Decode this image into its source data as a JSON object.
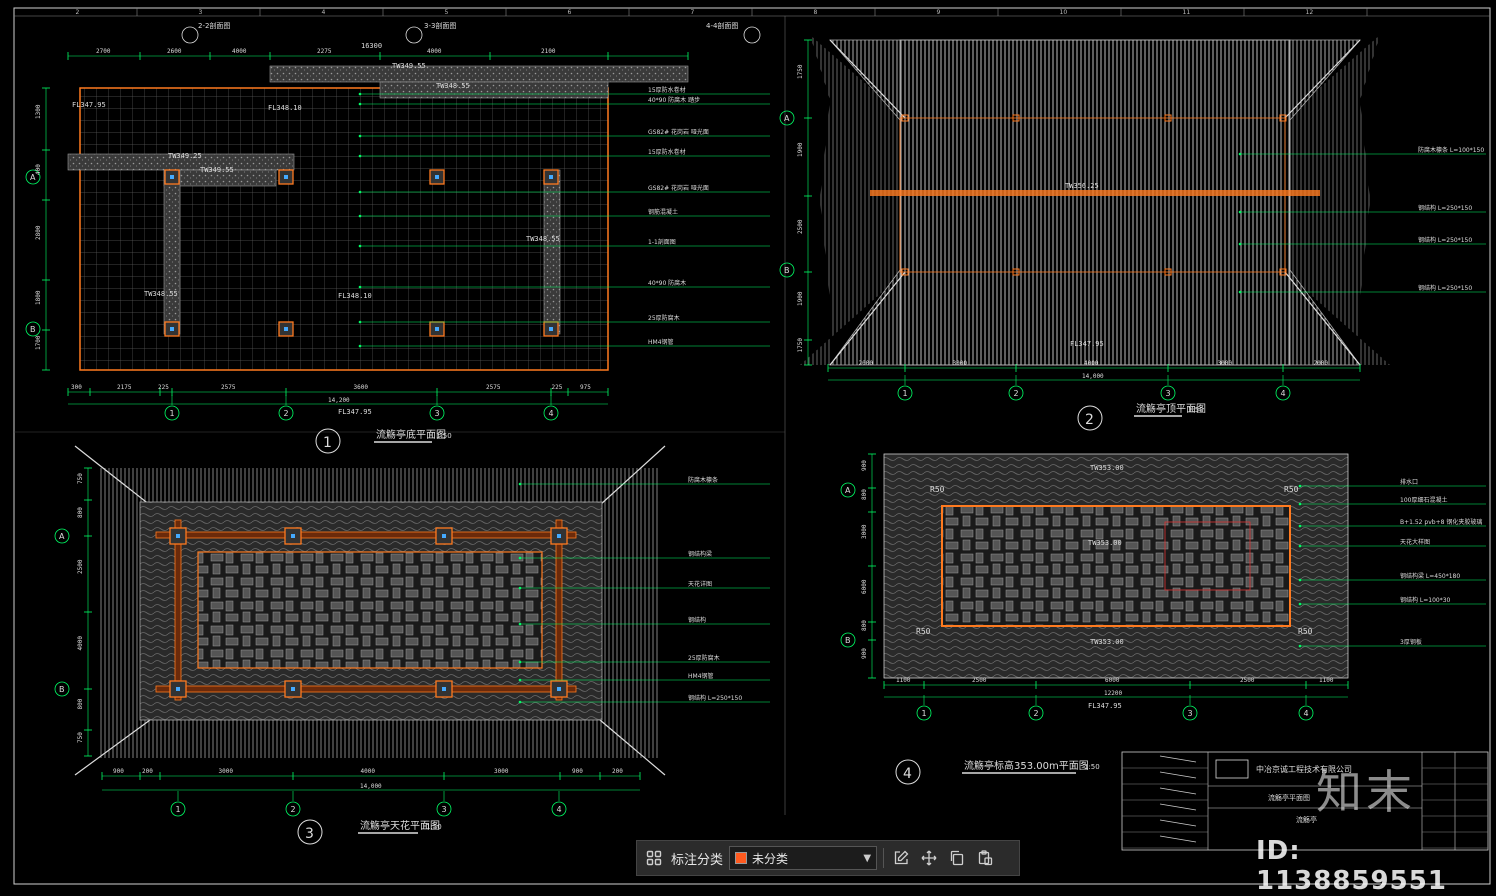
{
  "colors": {
    "bg": "#000000",
    "frame": "#ffffff",
    "dim": "#00ff66",
    "accent": "#ff7a1f",
    "hatch": "#777777",
    "label": "#dddddd"
  },
  "grid": {
    "cols": [
      "2",
      "3",
      "4",
      "5",
      "6",
      "7",
      "8",
      "9",
      "10",
      "11",
      "12"
    ],
    "rows": [
      "A",
      "B"
    ]
  },
  "view1": {
    "title": "流觞亭底平面图",
    "scale": "1:50",
    "number": "1",
    "top_dims": [
      "2700",
      "2600",
      "4000",
      "2275",
      "4000",
      "2100"
    ],
    "total": "16300",
    "bottom_dims": [
      "300",
      "2175",
      "225",
      "2575",
      "3600",
      "2575",
      "225",
      "975",
      "300"
    ],
    "bottom_total": "14,200",
    "axes": [
      "1",
      "2",
      "3",
      "4"
    ],
    "levels": {
      "a": "FL347.95",
      "b": "FL348.10",
      "c": "TW349.25",
      "d": "TW349.55",
      "e": "TW348.55",
      "f": "FL348.10",
      "g": "FL347.95"
    },
    "callouts": [
      "15厚防水卷材",
      "40*90 防腐木 踏步",
      "GS82# 花岗岩 哑光面",
      "15厚防水卷材",
      "GS82# 花岗岩 哑光面",
      "钢筋混凝土",
      "1-1剖面图",
      "40*90 防腐木",
      "25厚防腐木",
      "HM4钢管"
    ],
    "sections": [
      "2-2剖面图",
      "3-3剖面图",
      "4-4剖面图"
    ]
  },
  "view2": {
    "title": "流觞亭顶平面图",
    "scale": "1:50",
    "number": "2",
    "bottom_dims": [
      "2000",
      "3000",
      "4000",
      "3000",
      "2000"
    ],
    "total": "14,000",
    "axes": [
      "1",
      "2",
      "3",
      "4"
    ],
    "level": "FL347.95",
    "ridge": "TW356.25",
    "left_dims": [
      "1750",
      "1900",
      "2500",
      "1900",
      "1750"
    ],
    "callouts": [
      "防腐木檩条 L=100*150",
      "钢结构 L=250*150",
      "钢结构 L=250*150",
      "钢结构 L=250*150"
    ]
  },
  "view3": {
    "title": "流觞亭天花平面图",
    "scale": "1:50",
    "number": "3",
    "bottom_dims": [
      "900",
      "200",
      "3000",
      "4000",
      "3000",
      "900",
      "200"
    ],
    "total": "14,000",
    "axes": [
      "1",
      "2",
      "3",
      "4"
    ],
    "callouts": [
      "防腐木檩条",
      "钢结构梁",
      "天花详图",
      "钢结构",
      "25厚防腐木",
      "HM4钢管",
      "钢结构 L=250*150"
    ]
  },
  "view4": {
    "title": "流觞亭标高353.00m平面图",
    "scale": "1:50",
    "number": "4",
    "bottom_dims": [
      "1100",
      "2500",
      "6000",
      "2500",
      "1100"
    ],
    "total": "12200",
    "axes": [
      "1",
      "2",
      "3",
      "4"
    ],
    "level": "FL347.95",
    "tw_top": "TW353.00",
    "tw_mid": "TW353.00",
    "tw_bot": "TW353.00",
    "radius": "R50",
    "callouts": [
      "排水口",
      "100厚细石混凝土",
      "B+1.52 pvb+8 钢化夹胶玻璃",
      "天花大样图",
      "钢结构梁 L=450*180",
      "钢结构 L=100*30",
      "3厚钢板"
    ]
  },
  "titleblock": {
    "company": "中冶京诚工程技术有限公司",
    "project": "流觞亭",
    "drawing": "流觞亭平面图"
  },
  "toolbar": {
    "grid_icon": "grid-icon",
    "label": "标注分类",
    "select_value": "未分类",
    "swatch_color": "#ff5a1f"
  },
  "watermark": {
    "logo": "知末",
    "id": "ID: 1138859551"
  }
}
